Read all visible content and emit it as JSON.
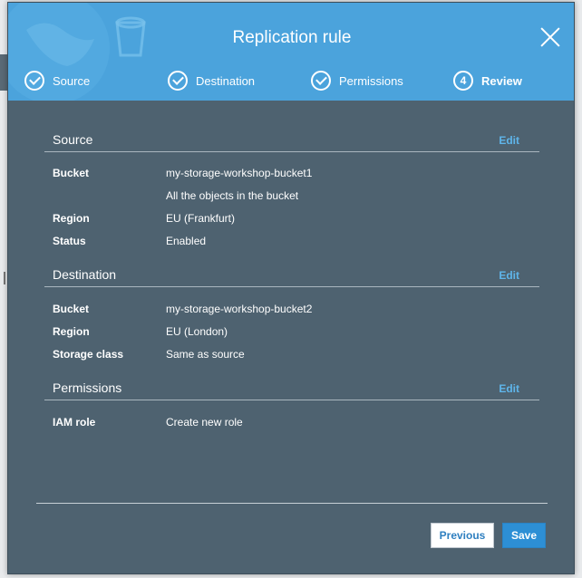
{
  "modal": {
    "title": "Replication rule"
  },
  "steps": [
    {
      "label": "Source",
      "state": "done",
      "icon": "check-circle-icon"
    },
    {
      "label": "Destination",
      "state": "done",
      "icon": "check-circle-icon"
    },
    {
      "label": "Permissions",
      "state": "done",
      "icon": "check-circle-icon"
    },
    {
      "label": "Review",
      "state": "active",
      "number": "4"
    }
  ],
  "sections": {
    "source": {
      "title": "Source",
      "edit": "Edit",
      "bucket_label": "Bucket",
      "bucket_value": "my-storage-workshop-bucket1",
      "scope_value": "All the objects in the bucket",
      "region_label": "Region",
      "region_value": "EU (Frankfurt)",
      "status_label": "Status",
      "status_value": "Enabled"
    },
    "destination": {
      "title": "Destination",
      "edit": "Edit",
      "bucket_label": "Bucket",
      "bucket_value": "my-storage-workshop-bucket2",
      "region_label": "Region",
      "region_value": "EU (London)",
      "storage_label": "Storage class",
      "storage_value": "Same as source"
    },
    "permissions": {
      "title": "Permissions",
      "edit": "Edit",
      "role_label": "IAM role",
      "role_value": "Create new role"
    }
  },
  "buttons": {
    "previous": "Previous",
    "save": "Save"
  },
  "colors": {
    "header": "#4ba3dc",
    "body": "#4e6270",
    "link": "#5fb5ea",
    "primary": "#2d8fd5"
  }
}
